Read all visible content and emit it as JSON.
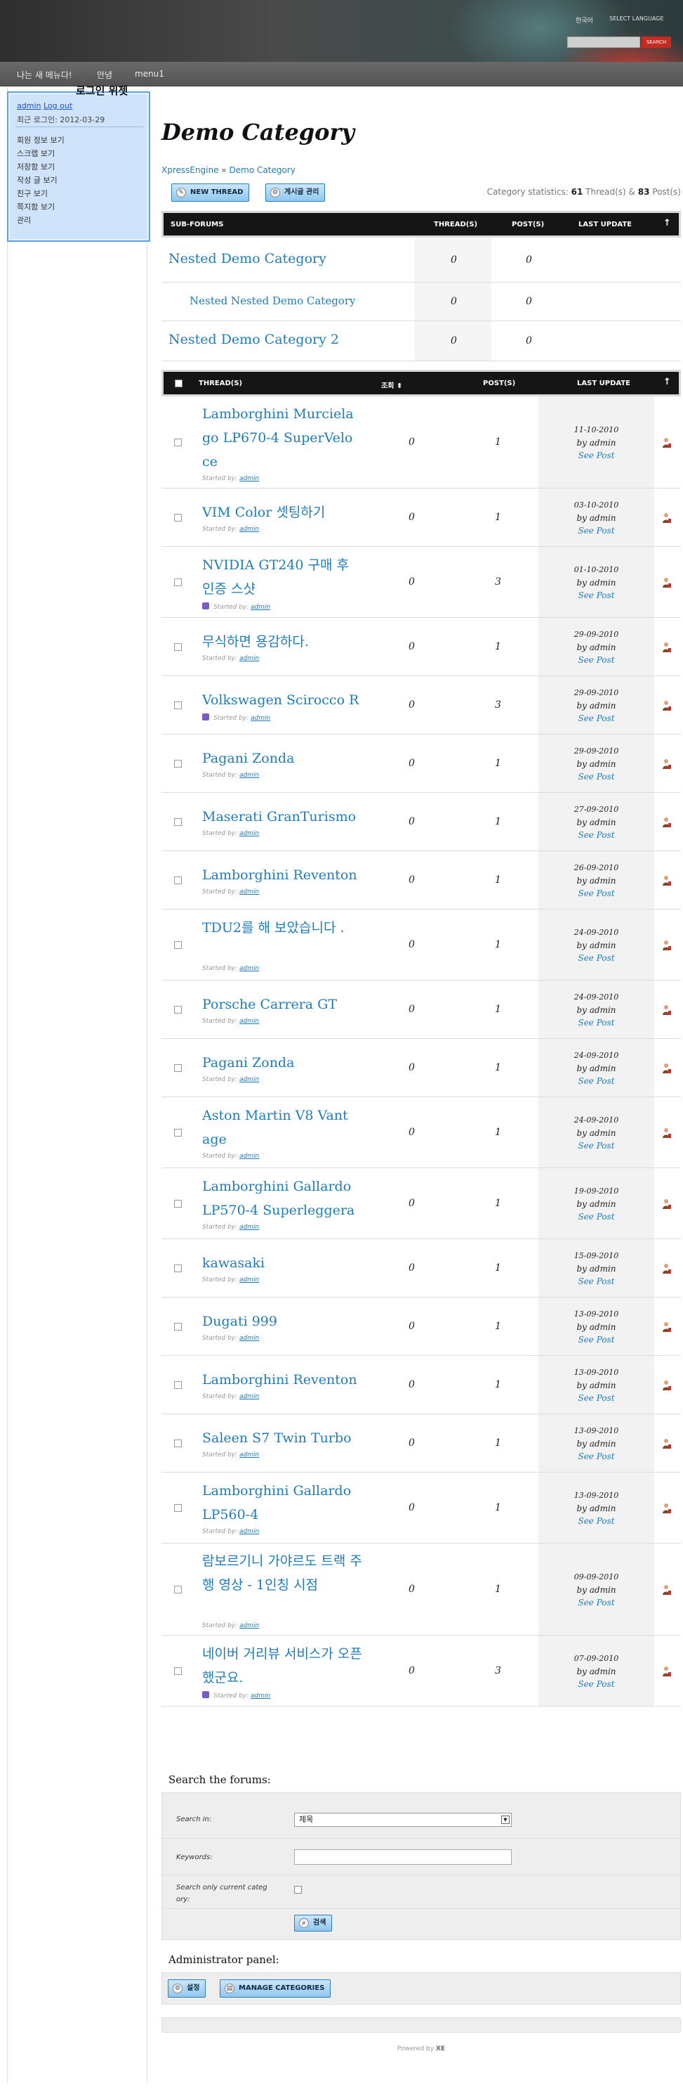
{
  "header": {
    "lang_label": "한국어",
    "lang_select": "SELECT LANGUAGE",
    "search_button": "SEARCH"
  },
  "topnav": {
    "items": [
      "나는 새 메뉴다!",
      "안녕",
      "menu1"
    ]
  },
  "login_widget": {
    "title": "로그인 위젯",
    "username": "admin",
    "logout": "Log out",
    "last_login": "최근 로그인: 2012-03-29",
    "menu": [
      "회원 정보 보기",
      "스크랩 보기",
      "저장함 보기",
      "작성 글 보기",
      "친구 보기",
      "쪽지함 보기",
      "관리"
    ]
  },
  "page": {
    "title": "Demo Category",
    "breadcrumb": [
      "XpressEngine",
      "Demo Category"
    ],
    "breadcrumb_sep": "»",
    "new_thread": "NEW THREAD",
    "manage_posts": "게시글 관리",
    "stats_label": "Category statistics:",
    "stats_threads": "61",
    "stats_threads_label": "Thread(s) &",
    "stats_posts": "83",
    "stats_posts_label": "Post(s)"
  },
  "subforums": {
    "headers": [
      "SUB-FORUMS",
      "THREAD(S)",
      "POST(S)",
      "LAST UPDATE",
      "↑"
    ],
    "rows": [
      {
        "name": "Nested Demo Category",
        "threads": "0",
        "posts": "0"
      },
      {
        "name": "Nested Nested Demo Category",
        "threads": "0",
        "posts": "0"
      },
      {
        "name": "Nested Demo Category 2",
        "threads": "0",
        "posts": "0"
      }
    ]
  },
  "threads": {
    "headers": [
      "THREAD(S)",
      "조회 ⬍",
      "POST(S)",
      "LAST UPDATE",
      "↑"
    ],
    "started_label": "Started by:",
    "by_label": "by",
    "see_post": "See Post",
    "rows": [
      {
        "title": "Lamborghini Murciela go LP670-4 SuperVelo ce",
        "lines": 3,
        "views": "0",
        "posts": "1",
        "date": "11-10-2010",
        "author": "admin",
        "icon": false
      },
      {
        "title": "VIM Color 셋팅하기",
        "lines": 1,
        "views": "0",
        "posts": "1",
        "date": "03-10-2010",
        "author": "admin",
        "icon": false
      },
      {
        "title": "NVIDIA GT240 구매 후 인증 스샷",
        "lines": 2,
        "views": "0",
        "posts": "3",
        "date": "01-10-2010",
        "author": "admin",
        "icon": true
      },
      {
        "title": "무식하면 용감하다.",
        "lines": 1,
        "views": "0",
        "posts": "1",
        "date": "29-09-2010",
        "author": "admin",
        "icon": false
      },
      {
        "title": "Volkswagen Scirocco R",
        "lines": 1,
        "views": "0",
        "posts": "3",
        "date": "29-09-2010",
        "author": "admin",
        "icon": true
      },
      {
        "title": "Pagani Zonda",
        "lines": 1,
        "views": "0",
        "posts": "1",
        "date": "29-09-2010",
        "author": "admin",
        "icon": false
      },
      {
        "title": "Maserati GranTurismo",
        "lines": 1,
        "views": "0",
        "posts": "1",
        "date": "27-09-2010",
        "author": "admin",
        "icon": false
      },
      {
        "title": "Lamborghini Reventon",
        "lines": 1,
        "views": "0",
        "posts": "1",
        "date": "26-09-2010",
        "author": "admin",
        "icon": false
      },
      {
        "title": "TDU2를 해 보았습니다 .",
        "lines": 2,
        "views": "0",
        "posts": "1",
        "date": "24-09-2010",
        "author": "admin",
        "icon": false
      },
      {
        "title": "Porsche Carrera GT",
        "lines": 1,
        "views": "0",
        "posts": "1",
        "date": "24-09-2010",
        "author": "admin",
        "icon": false
      },
      {
        "title": "Pagani Zonda",
        "lines": 1,
        "views": "0",
        "posts": "1",
        "date": "24-09-2010",
        "author": "admin",
        "icon": false
      },
      {
        "title": "Aston Martin V8 Vant age",
        "lines": 2,
        "views": "0",
        "posts": "1",
        "date": "24-09-2010",
        "author": "admin",
        "icon": false
      },
      {
        "title": "Lamborghini Gallardo LP570-4 Superleggera",
        "lines": 2,
        "views": "0",
        "posts": "1",
        "date": "19-09-2010",
        "author": "admin",
        "icon": false
      },
      {
        "title": "kawasaki",
        "lines": 1,
        "views": "0",
        "posts": "1",
        "date": "15-09-2010",
        "author": "admin",
        "icon": false
      },
      {
        "title": "Dugati 999",
        "lines": 1,
        "views": "0",
        "posts": "1",
        "date": "13-09-2010",
        "author": "admin",
        "icon": false
      },
      {
        "title": "Lamborghini Reventon",
        "lines": 1,
        "views": "0",
        "posts": "1",
        "date": "13-09-2010",
        "author": "admin",
        "icon": false
      },
      {
        "title": "Saleen S7 Twin Turbo",
        "lines": 1,
        "views": "0",
        "posts": "1",
        "date": "13-09-2010",
        "author": "admin",
        "icon": false
      },
      {
        "title": "Lamborghini Gallardo LP560-4",
        "lines": 2,
        "views": "0",
        "posts": "1",
        "date": "13-09-2010",
        "author": "admin",
        "icon": false
      },
      {
        "title": "람보르기니 가야르도 트랙 주행 영상 - 1인칭 시점",
        "lines": 3,
        "views": "0",
        "posts": "1",
        "date": "09-09-2010",
        "author": "admin",
        "icon": false
      },
      {
        "title": "네이버 거리뷰 서비스가 오픈했군요.",
        "lines": 2,
        "views": "0",
        "posts": "3",
        "date": "07-09-2010",
        "author": "admin",
        "icon": true
      }
    ]
  },
  "search": {
    "title": "Search the forums:",
    "search_in_label": "Search in:",
    "search_in_value": "제목",
    "keywords_label": "Keywords:",
    "only_current_label": "Search only current categ ory:",
    "button": "검색"
  },
  "admin": {
    "title": "Administrator panel:",
    "settings": "설정",
    "manage_categories": "MANAGE CATEGORIES"
  },
  "footer": {
    "powered_by": "Powered by",
    "brand": "XE"
  }
}
